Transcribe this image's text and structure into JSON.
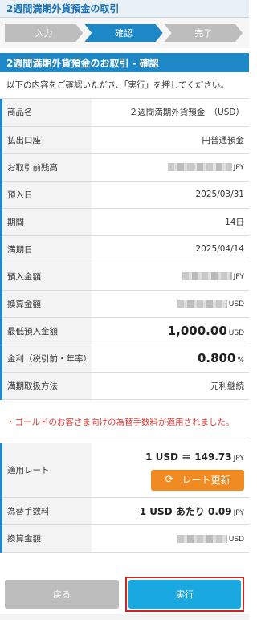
{
  "header": {
    "title": "2週間満期外貨預金の取引"
  },
  "steps": [
    {
      "label": "入力",
      "active": false
    },
    {
      "label": "確認",
      "active": true
    },
    {
      "label": "完了",
      "active": false
    }
  ],
  "section": {
    "title": "2週間満期外貨預金のお取引 - 確認"
  },
  "intro": "以下の内容をご確認いただき、「実行」を押してください。",
  "rows": {
    "product": {
      "label": "商品名",
      "value": "２週間満期外貨預金　（USD）"
    },
    "account": {
      "label": "払出口座",
      "value": "円普通預金"
    },
    "balance": {
      "label": "お取引前残高",
      "unit": "JPY"
    },
    "deposit_date": {
      "label": "預入日",
      "value": "2025/03/31"
    },
    "term": {
      "label": "期間",
      "value": "14日"
    },
    "maturity": {
      "label": "満期日",
      "value": "2025/04/14"
    },
    "deposit_amount": {
      "label": "預入金額",
      "unit": "JPY"
    },
    "converted": {
      "label": "換算金額",
      "unit": "USD"
    },
    "min_deposit": {
      "label": "最低預入金額",
      "value": "1,000.00",
      "unit": "USD"
    },
    "interest": {
      "label": "金利（税引前・年率）",
      "value": "0.800",
      "unit": "%"
    },
    "maturity_handling": {
      "label": "満期取扱方法",
      "value": "元利継続"
    }
  },
  "notice": "・ゴールドのお客さま向けの為替手数料が適用されました。",
  "rate": {
    "label": "適用レート",
    "value": "1 USD ＝ 149.73",
    "unit": "JPY",
    "refresh_label": "レート更新",
    "refresh_icon": "refresh-icon"
  },
  "fee": {
    "label": "為替手数料",
    "value": "1 USD あたり 0.09",
    "unit": "JPY"
  },
  "converted2": {
    "label": "換算金額",
    "unit": "USD"
  },
  "buttons": {
    "back": "戻る",
    "execute": "実行"
  },
  "colors": {
    "primary": "#1e88c7",
    "accent": "#f08b24",
    "notice": "#e53935",
    "execute": "#1aa8e0"
  }
}
